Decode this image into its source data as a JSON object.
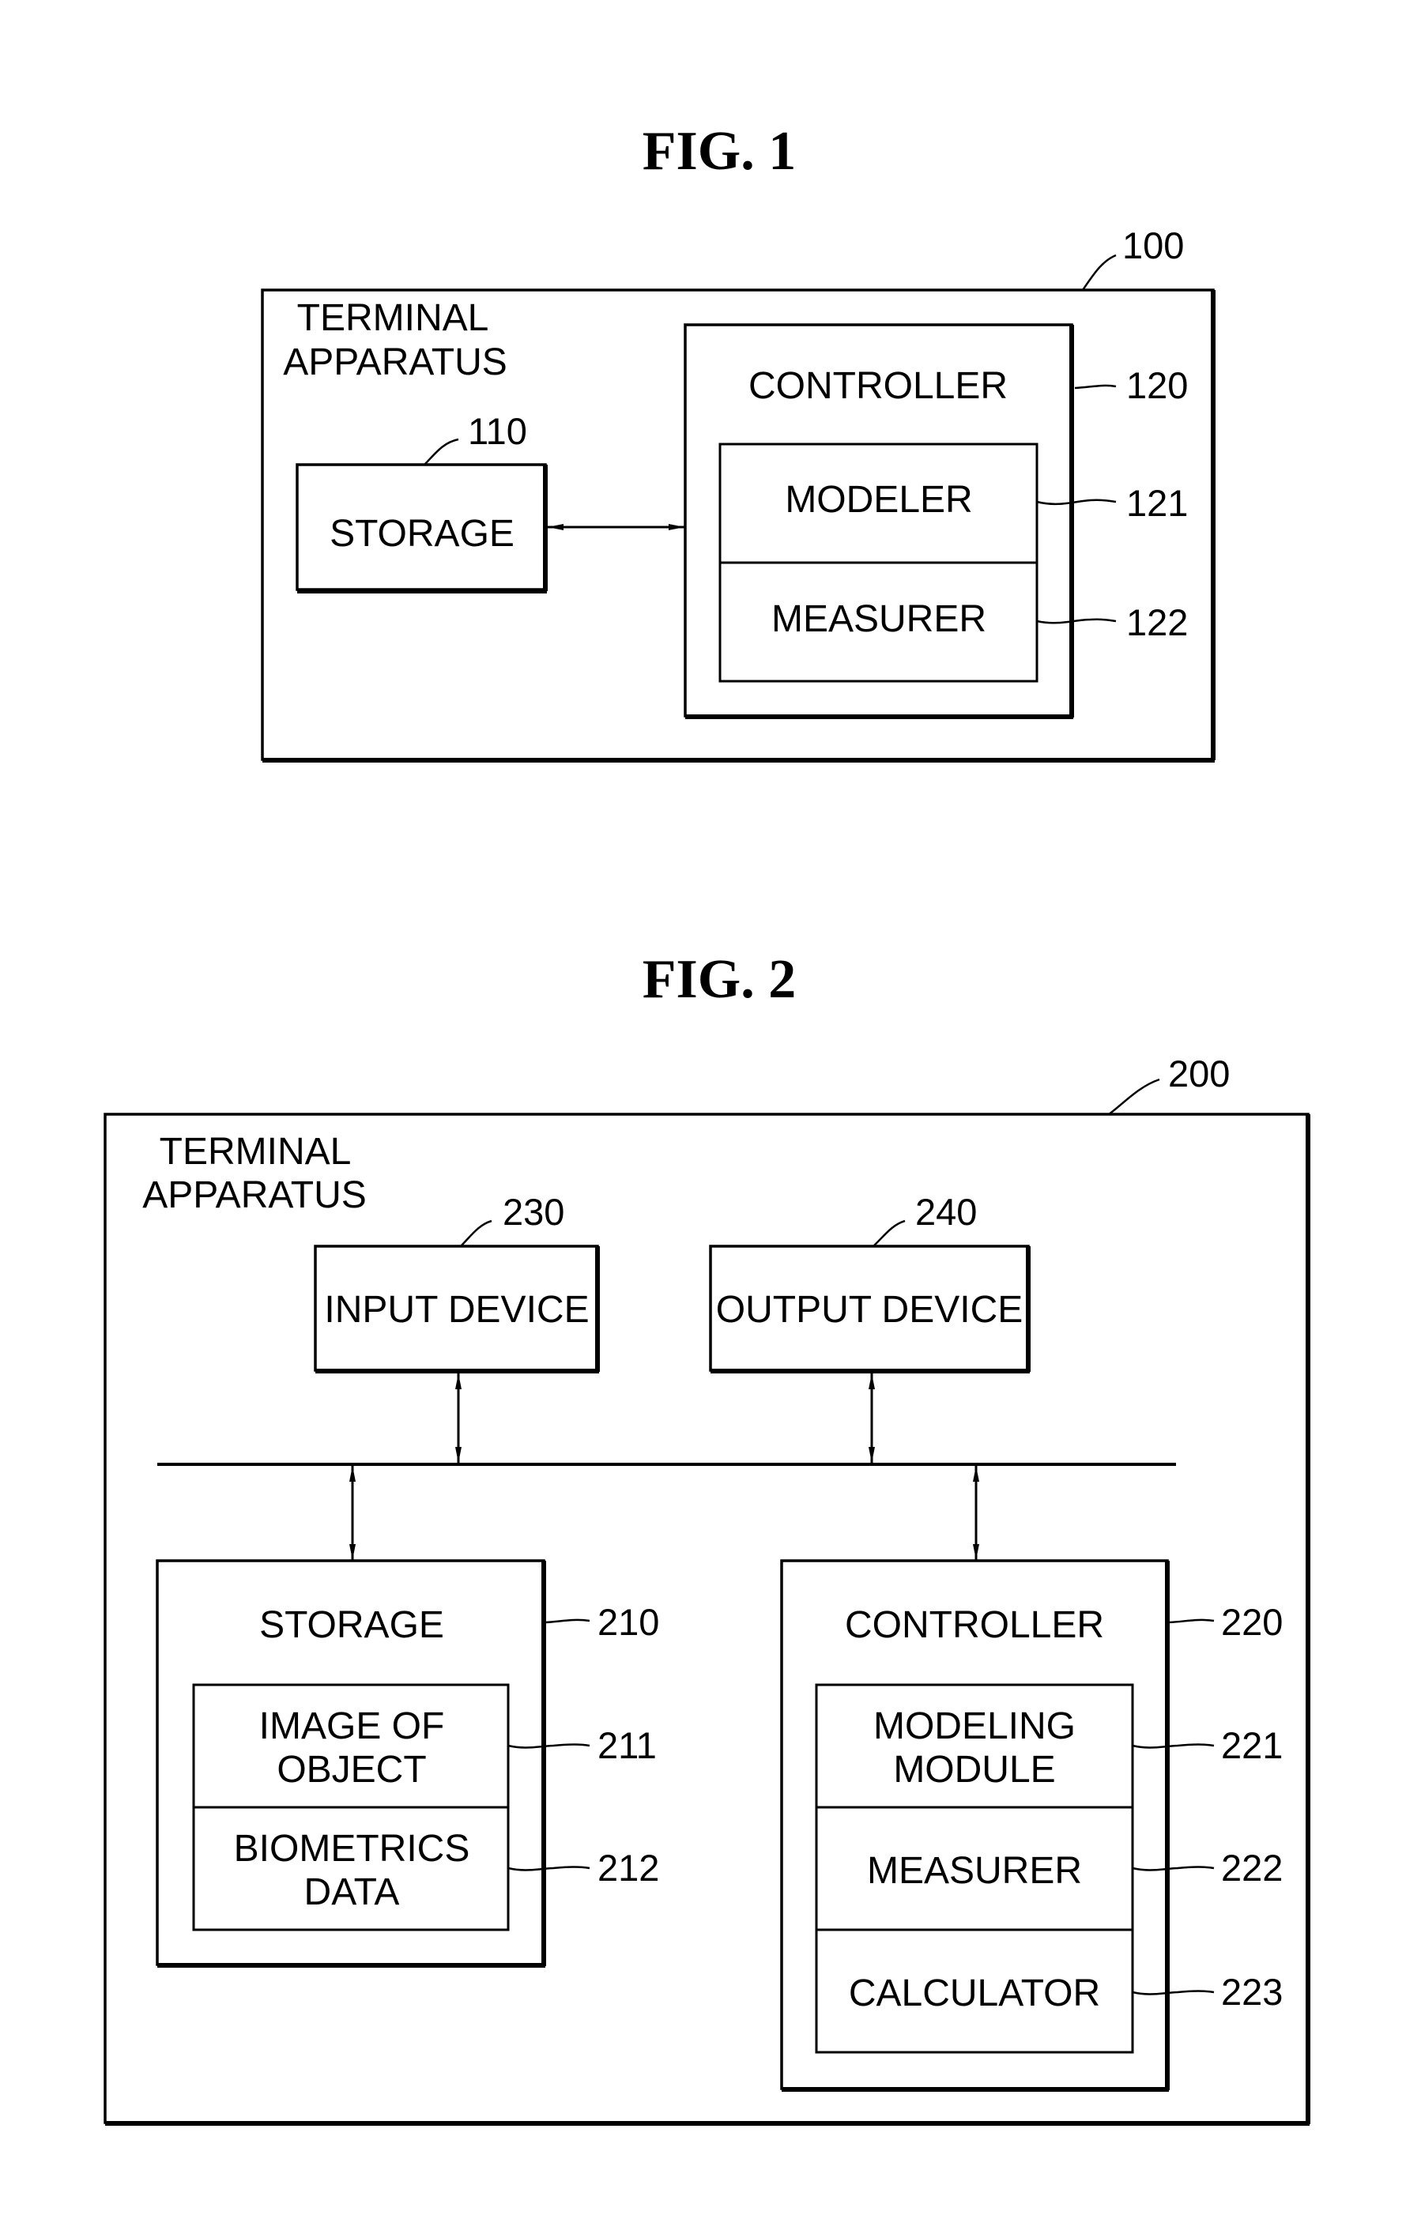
{
  "figures": [
    {
      "title": "FIG.  1",
      "apparatus": {
        "ref": "100",
        "label_line1": "TERMINAL",
        "label_line2": "APPARATUS"
      },
      "storage": {
        "ref": "110",
        "label": "STORAGE"
      },
      "controller": {
        "ref": "120",
        "label": "CONTROLLER",
        "modules": [
          {
            "ref": "121",
            "label": "MODELER"
          },
          {
            "ref": "122",
            "label": "MEASURER"
          }
        ]
      },
      "connections": [
        {
          "from": "STORAGE",
          "to": "CONTROLLER",
          "type": "bidirectional"
        }
      ]
    },
    {
      "title": "FIG.  2",
      "apparatus": {
        "ref": "200",
        "label_line1": "TERMINAL",
        "label_line2": "APPARATUS"
      },
      "input_device": {
        "ref": "230",
        "label": "INPUT DEVICE"
      },
      "output_device": {
        "ref": "240",
        "label": "OUTPUT DEVICE"
      },
      "storage": {
        "ref": "210",
        "label": "STORAGE",
        "modules": [
          {
            "ref": "211",
            "line1": "IMAGE OF",
            "line2": "OBJECT"
          },
          {
            "ref": "212",
            "line1": "BIOMETRICS",
            "line2": "DATA"
          }
        ]
      },
      "controller": {
        "ref": "220",
        "label": "CONTROLLER",
        "modules": [
          {
            "ref": "221",
            "line1": "MODELING",
            "line2": "MODULE"
          },
          {
            "ref": "222",
            "line1": "MEASURER"
          },
          {
            "ref": "223",
            "line1": "CALCULATOR"
          }
        ]
      },
      "connections": [
        {
          "from": "INPUT DEVICE",
          "to": "bus",
          "type": "bidirectional"
        },
        {
          "from": "OUTPUT DEVICE",
          "to": "bus",
          "type": "bidirectional"
        },
        {
          "from": "STORAGE",
          "to": "bus",
          "type": "bidirectional"
        },
        {
          "from": "CONTROLLER",
          "to": "bus",
          "type": "bidirectional"
        }
      ]
    }
  ]
}
